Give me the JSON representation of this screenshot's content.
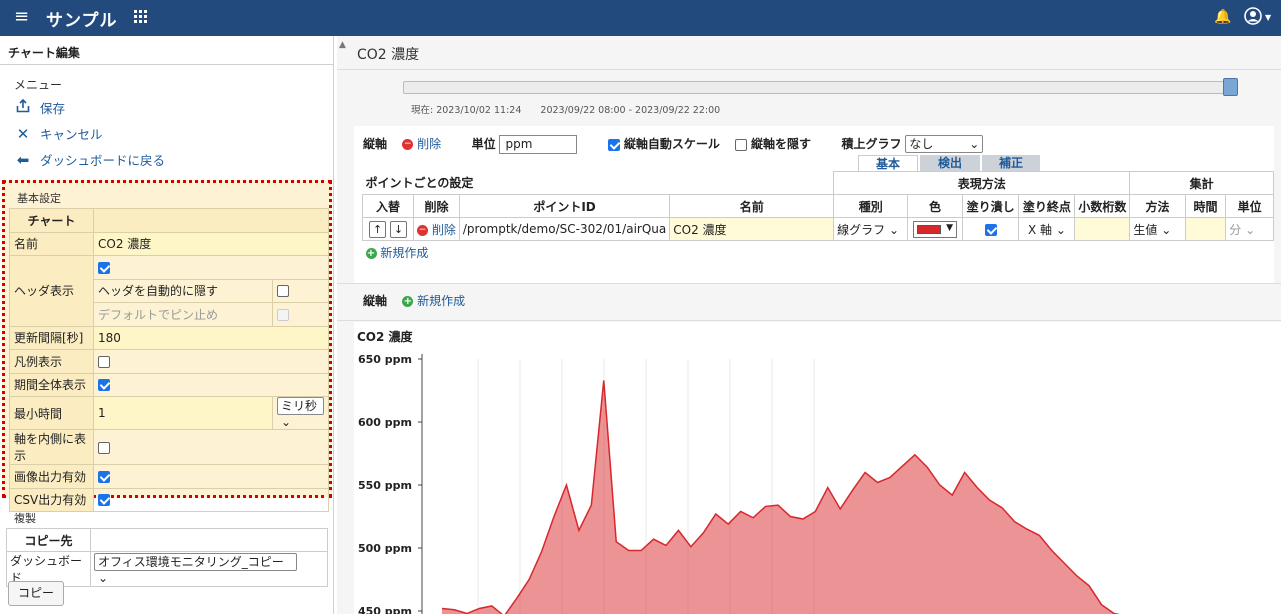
{
  "app": {
    "title": "サンプル"
  },
  "left": {
    "title": "チャート編集",
    "menu_heading": "メニュー",
    "menu": [
      {
        "label": "保存",
        "icon": "share-upload-icon"
      },
      {
        "label": "キャンセル",
        "icon": "close-icon"
      },
      {
        "label": "ダッシュボードに戻る",
        "icon": "back-arrow-icon"
      }
    ],
    "basic": {
      "heading": "基本設定",
      "col_header": "チャート",
      "name_label": "名前",
      "name_value": "CO2 濃度",
      "header_label": "ヘッダ表示",
      "autohide_label": "ヘッダを自動的に隠す",
      "pin_label": "デフォルトでピン止め",
      "interval_label": "更新間隔[秒]",
      "interval_value": "180",
      "legend_label": "凡例表示",
      "fullperiod_label": "期間全体表示",
      "mintime_label": "最小時間",
      "mintime_value": "1",
      "mintime_unit": "ミリ秒",
      "axisinside_label": "軸を内側に表示",
      "image_label": "画像出力有効",
      "csv_label": "CSV出力有効"
    },
    "dup": {
      "heading": "複製",
      "copyto_header": "コピー先",
      "dashboard_label": "ダッシュボード",
      "dashboard_value": "オフィス環境モニタリング_コピー",
      "copy_button": "コピー"
    }
  },
  "right": {
    "chart_title": "CO2 濃度",
    "time": {
      "now": "現在: 2023/10/02 11:24",
      "range": "2023/09/22 08:00 - 2023/09/22 22:00"
    },
    "axis": {
      "vaxis_label": "縦軸",
      "delete_label": "削除",
      "unit_label": "単位",
      "unit_value": "ppm",
      "autoscale_label": "縦軸自動スケール",
      "hide_label": "縦軸を隠す",
      "stack_label": "積上グラフ",
      "stack_value": "なし",
      "tabs": [
        "基本",
        "検出",
        "補正"
      ],
      "points_heading": "ポイントごとの設定",
      "group_expr": "表現方法",
      "group_agg": "集計",
      "headers": [
        "入替",
        "削除",
        "ポイントID",
        "名前",
        "種別",
        "色",
        "塗り潰し",
        "塗り終点",
        "小数桁数",
        "方法",
        "時間",
        "単位"
      ],
      "row": {
        "delete": "削除",
        "point_id": "/promptk/demo/SC-302/01/airQua",
        "name": "CO2 濃度",
        "type": "線グラフ",
        "color": "#d7282b",
        "fill_end": "X 軸",
        "method": "生値",
        "unit": "分"
      },
      "new_label": "新規作成"
    },
    "vaxis_new": {
      "label": "縦軸",
      "new": "新規作成"
    }
  },
  "chart_data": {
    "type": "area",
    "title": "CO2 濃度",
    "ylabel_unit": "ppm",
    "y_ticks": [
      "650 ppm",
      "600 ppm",
      "550 ppm",
      "500 ppm",
      "450 ppm"
    ],
    "ylim": [
      440,
      652
    ],
    "x": [
      0,
      2,
      4,
      6,
      8,
      10,
      12,
      14,
      16,
      18,
      20,
      22,
      24,
      26,
      28,
      30,
      32,
      34,
      36,
      38,
      40,
      42,
      44,
      46,
      48,
      50,
      52,
      54,
      56,
      58,
      60,
      62,
      64,
      66,
      68,
      70,
      72,
      74,
      76,
      78,
      80,
      82,
      84,
      86,
      88,
      90,
      92,
      94,
      96,
      98,
      100,
      102,
      104,
      106,
      108,
      110
    ],
    "values": [
      452,
      451,
      448,
      452,
      454,
      446,
      460,
      475,
      497,
      525,
      550,
      514,
      534,
      633,
      505,
      498,
      498,
      507,
      502,
      514,
      501,
      512,
      527,
      519,
      529,
      524,
      533,
      534,
      525,
      523,
      529,
      548,
      531,
      546,
      560,
      552,
      556,
      565,
      574,
      564,
      550,
      542,
      560,
      548,
      538,
      532,
      521,
      515,
      510,
      498,
      488,
      478,
      470,
      455,
      448,
      446
    ],
    "series": [
      {
        "name": "CO2 濃度",
        "color": "#d7282b"
      }
    ]
  }
}
